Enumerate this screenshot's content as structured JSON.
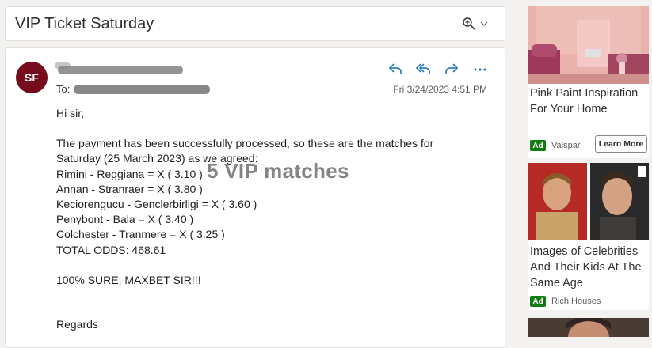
{
  "subject": {
    "title": "VIP Ticket Saturday"
  },
  "message": {
    "avatar_initials": "SF",
    "to_label": "To:",
    "date": "Fri 3/24/2023 4:51 PM",
    "actions": [
      "reply-icon",
      "reply-all-icon",
      "forward-icon",
      "more-icon"
    ],
    "body": {
      "greeting": "Hi sir,",
      "line1": "The payment has been successfully processed, so these are the matches for",
      "line2": "Saturday (25 March 2023) as we agreed:",
      "matches": [
        "Rimini - Reggiana = X ( 3.10 )",
        "Annan - Stranraer = X ( 3.80 )",
        "Keciorengucu - Genclerbirligi = X ( 3.60 )",
        "Penybont - Bala = X ( 3.40 )",
        "Colchester - Tranmere = X ( 3.25 )"
      ],
      "total": "TOTAL ODDS: 468.61",
      "sure": "100% SURE, MAXBET SIR!!!",
      "regards": "Regards"
    },
    "overlay_caption": "5 VIP matches",
    "avatar_color": "#750b1c"
  },
  "ads": [
    {
      "title": "Pink Paint Inspiration For Your Home",
      "badge": "Ad",
      "source": "Valspar",
      "button": "Learn More"
    },
    {
      "title": "Images of Celebrities And Their Kids At The Same Age",
      "badge": "Ad",
      "source": "Rich Houses"
    }
  ]
}
